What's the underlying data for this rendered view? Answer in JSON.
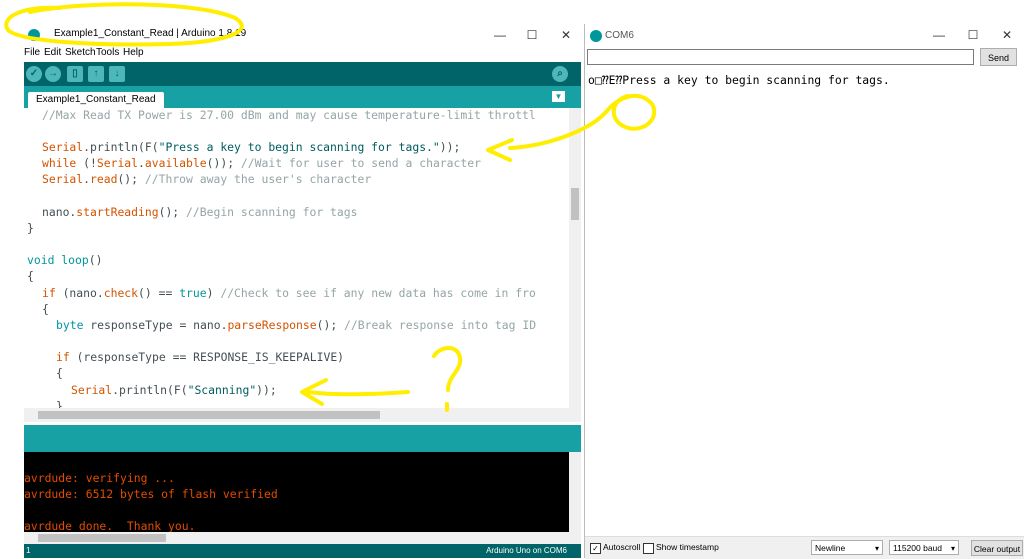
{
  "ide": {
    "title": "Example1_Constant_Read | Arduino 1.8.19",
    "menu": [
      "File",
      "Edit",
      "Sketch",
      "Tools",
      "Help"
    ],
    "tab_label": "Example1_Constant_Read",
    "code": {
      "l1": "//Max Read TX Power is 27.00 dBm and may cause temperature-limit throttl",
      "l3a": "Serial",
      "l3b": ".println(F(",
      "l3c": "\"Press a key to begin scanning for tags.\"",
      "l3d": "));",
      "l4a": "while",
      "l4b": " (!",
      "l4c": "Serial",
      "l4d": ".",
      "l4e": "available",
      "l4f": "()); ",
      "l4g": "//Wait for user to send a character",
      "l5a": "Serial",
      "l5b": ".",
      "l5c": "read",
      "l5d": "(); ",
      "l5e": "//Throw away the user's character",
      "l7a": "nano.",
      "l7b": "startReading",
      "l7c": "(); ",
      "l7d": "//Begin scanning for tags",
      "l8": "}",
      "l10a": "void",
      "l10b": " ",
      "l10c": "loop",
      "l10d": "()",
      "l11": "{",
      "l12a": "if",
      "l12b": " (nano.",
      "l12c": "check",
      "l12d": "() == ",
      "l12e": "true",
      "l12f": ") ",
      "l12g": "//Check to see if any new data has come in fro",
      "l13": "{",
      "l14a": "byte",
      "l14b": " responseType = nano.",
      "l14c": "parseResponse",
      "l14d": "(); ",
      "l14e": "//Break response into tag ID",
      "l16a": "if",
      "l16b": " (responseType == RESPONSE_IS_KEEPALIVE)",
      "l17": "{",
      "l18a": "Serial",
      "l18b": ".println(F(",
      "l18c": "\"Scanning\"",
      "l18d": "));",
      "l19": "}"
    },
    "console": [
      "avrdude: verifying ...",
      "avrdude: 6512 bytes of flash verified",
      "",
      "avrdude done.  Thank you."
    ],
    "footer_left": "1",
    "footer_right": "Arduino Uno on COM6"
  },
  "serial": {
    "title": "COM6",
    "input_value": "",
    "send_label": "Send",
    "output_line": "o□⁇E⁇Press a key to begin scanning for tags.",
    "autoscroll_label": "Autoscroll",
    "autoscroll_checked": true,
    "timestamp_label": "Show timestamp",
    "timestamp_checked": false,
    "line_ending": "Newline",
    "baud": "115200 baud",
    "clear_label": "Clear output"
  },
  "annotation": {
    "question_mark": "?",
    "color": "#ffee00"
  }
}
